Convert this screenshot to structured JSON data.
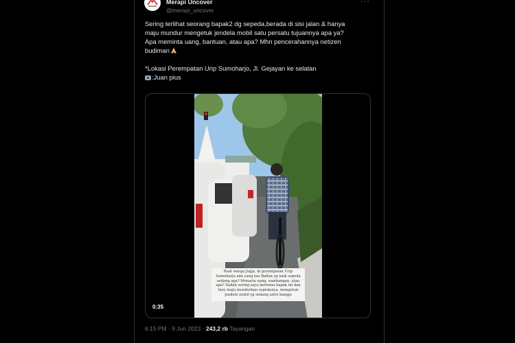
{
  "author": {
    "name": "Merapi Uncover",
    "handle": "@merapi_uncover",
    "avatar_icon": "mountain-logo-icon"
  },
  "more_label": "···",
  "tweet": {
    "line1": "Sering terlihat seorang bapak2 dg sepeda,berada di sisi jalan & hanya\nmaju mundur mengetuk jendela mobil satu persatu tujuannya apa ya?\nApa meminta uang, bantuan, atau apa? Mhn pencerahannya netizen\nbudiman",
    "location": "*Lokasi Perempatan Urip Sumoharjo, Jl. Gejayan ke selatan",
    "credit": ":Juan pius"
  },
  "video": {
    "caption": "Buat warga Jogja, di perempatan Urip\nSumoharjo ada yang tau Bañ̃an yg naik sepeda\nsedang apa? Menarta uang, sumbangan, atau\napa? Sudah sering saya bertemu bapak ini dan\nbeiy maju mundurkan sepedanya, mengetuk\njendela mobil yg sedang antri bangjo",
    "duration": "0:35"
  },
  "meta": {
    "time": "6:15 PM · 9 Jun 2023 ·",
    "views": "243,2 rb",
    "views_label": "Tayangan"
  },
  "colors": {
    "background": "#000000",
    "text": "#e7e9ea",
    "muted": "#71767b",
    "border": "#2f3336"
  }
}
